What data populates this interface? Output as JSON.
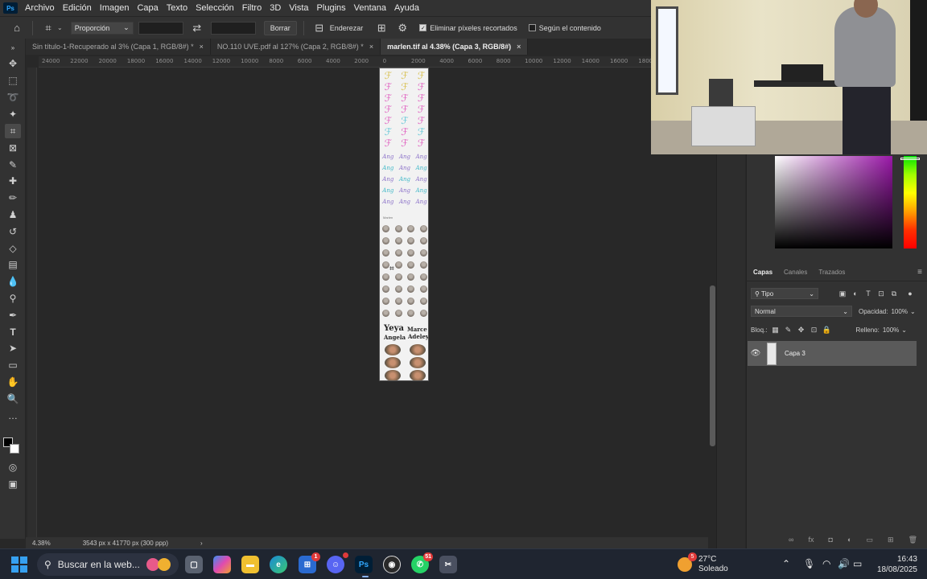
{
  "menu": {
    "logo": "Ps",
    "items": [
      "Archivo",
      "Edición",
      "Imagen",
      "Capa",
      "Texto",
      "Selección",
      "Filtro",
      "3D",
      "Vista",
      "Plugins",
      "Ventana",
      "Ayuda"
    ]
  },
  "options": {
    "ratio_select": "Proporción",
    "clear_button": "Borrar",
    "straighten_label": "Enderezar",
    "delete_cropped_label": "Eliminar píxeles recortados",
    "delete_cropped_checked": true,
    "content_aware_label": "Según el contenido",
    "content_aware_checked": false
  },
  "tabs": [
    {
      "label": "Sin título-1-Recuperado al 3% (Capa 1, RGB/8#) *",
      "active": false
    },
    {
      "label": "NO.110 UVE.pdf al 127% (Capa 2, RGB/8#) *",
      "active": false
    },
    {
      "label": "marlen.tif al 4.38% (Capa 3, RGB/8#)",
      "active": true
    }
  ],
  "ruler": {
    "labels": [
      "24000",
      "22000",
      "20000",
      "18000",
      "16000",
      "14000",
      "12000",
      "10000",
      "8000",
      "6000",
      "4000",
      "2000",
      "0",
      "2000",
      "4000",
      "6000",
      "8000",
      "10000",
      "12000",
      "14000",
      "16000",
      "18000"
    ]
  },
  "document": {
    "name_1": "Yeya",
    "name_2": "Angela",
    "name_3": "Marce",
    "name_4": "Adeley",
    "small_text": "Marlen"
  },
  "status": {
    "zoom": "4.38%",
    "doc_info": "3543 px x 41770 px (300 ppp)",
    "arrow": "›"
  },
  "layers_panel": {
    "tabs": [
      "Capas",
      "Canales",
      "Trazados"
    ],
    "filter_select": "Tipo",
    "blend_mode": "Normal",
    "opacity_label": "Opacidad:",
    "opacity_value": "100%",
    "lock_label": "Bloq.:",
    "fill_label": "Relleno:",
    "fill_value": "100%",
    "layer_name": "Capa 3"
  },
  "taskbar": {
    "search_placeholder": "Buscar en la web...",
    "ps_label": "Ps",
    "app_badge": "1",
    "whatsapp_badge": "51",
    "weather_badge": "5",
    "temperature": "27°C",
    "condition": "Soleado",
    "time": "16:43",
    "date": "18/08/2025"
  },
  "colors": {
    "accent_blue": "#31a8ff",
    "panel_bg": "#323232",
    "canvas_bg": "#282828",
    "picker_hue": "#9a18a8"
  }
}
